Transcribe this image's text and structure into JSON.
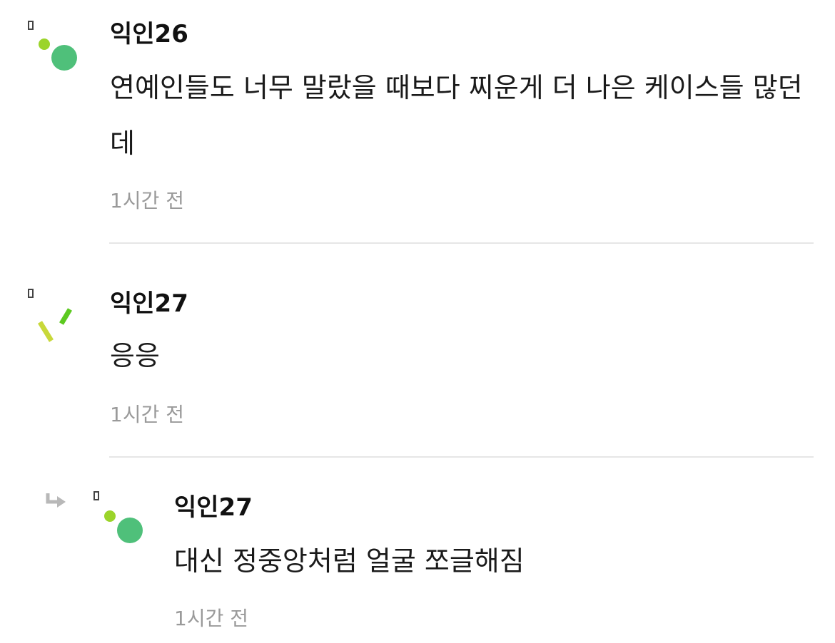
{
  "comments": [
    {
      "author": "익인26",
      "body": "연예인들도 너무 말랐을 때보다 찌운게 더 나은 케이스들 많던데",
      "time": "1시간 전",
      "avatar_icon": "avatar-dots-icon",
      "colors": {
        "dot_small": "#9bd42a",
        "dot_large": "#4fc07a"
      }
    },
    {
      "author": "익인27",
      "body": "응응",
      "time": "1시간 전",
      "avatar_icon": "avatar-slashes-icon",
      "colors": {
        "stroke_left": "#c8d83a",
        "stroke_right": "#5cc920"
      }
    },
    {
      "author": "익인27",
      "body": "대신 정중앙처럼 얼굴 쪼글해짐",
      "time": "1시간 전",
      "is_reply": true,
      "avatar_icon": "avatar-dots-icon",
      "reply_icon": "reply-arrow-icon",
      "colors": {
        "dot_small": "#9bd42a",
        "dot_large": "#4fc07a"
      }
    }
  ]
}
